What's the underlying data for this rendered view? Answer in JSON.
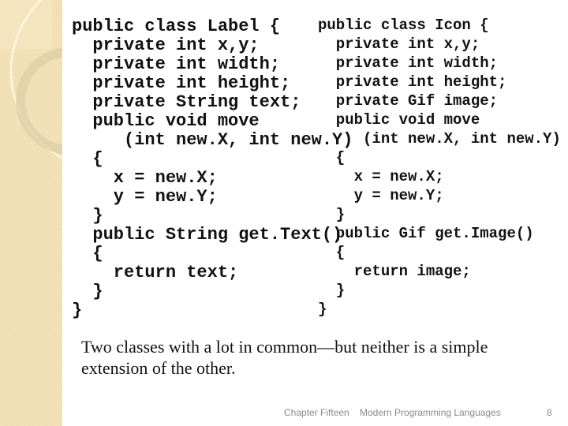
{
  "slide": {
    "left_code": [
      "public class Label {",
      "  private int x,y;",
      "  private int width;",
      "  private int height;",
      "  private String text;",
      "  public void move",
      "     (int new.X, int new.Y)",
      "  {",
      "    x = new.X;",
      "    y = new.Y;",
      "  }",
      "  public String get.Text()",
      "  {",
      "    return text;",
      "  }",
      "}"
    ],
    "right_code": [
      "public class Icon {",
      "  private int x,y;",
      "  private int width;",
      "  private int height;",
      "  private Gif image;",
      "  public void move",
      "     (int new.X, int new.Y)",
      "  {",
      "    x = new.X;",
      "    y = new.Y;",
      "  }",
      "  public Gif get.Image()",
      "  {",
      "    return image;",
      "  }",
      "}"
    ],
    "caption": "Two classes with a lot in common—but neither is a simple extension of the other.",
    "footer": {
      "chapter": "Chapter Fifteen",
      "title": "Modern Programming Languages",
      "page": "8"
    }
  },
  "colors": {
    "sidebar": "#f1deb0"
  }
}
